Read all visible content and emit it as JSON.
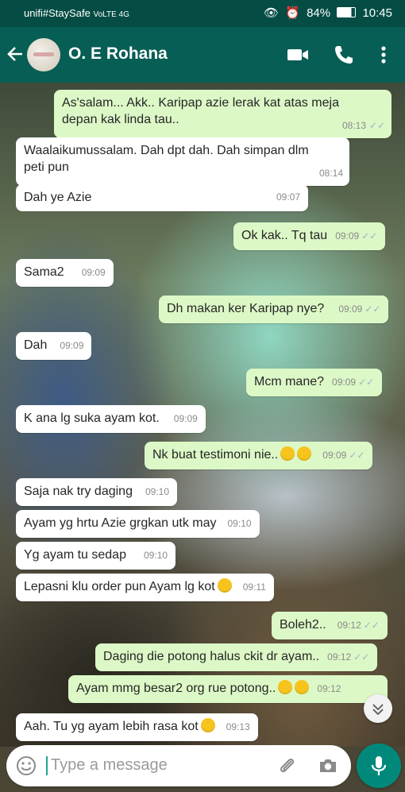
{
  "status_bar": {
    "carrier": "unifi#StaySafe",
    "network_badges": "VoLTE 4G",
    "battery": "84%",
    "time": "10:45"
  },
  "header": {
    "contact_name": "O. E Rohana"
  },
  "messages": [
    {
      "dir": "out",
      "lines": [
        "As'salam... Akk.. Karipap azie lerak kat atas meja",
        "depan kak linda tau.."
      ],
      "time": "08:13"
    },
    {
      "dir": "in",
      "lines": [
        "Waalaikumussalam. Dah dpt dah. Dah simpan dlm",
        "peti pun"
      ],
      "time": "08:14"
    },
    {
      "dir": "in",
      "text": "Dah ye Azie",
      "time": "09:07"
    },
    {
      "dir": "out",
      "text": "Ok kak.. Tq tau",
      "time": "09:09"
    },
    {
      "dir": "in",
      "text": "Sama2",
      "time": "09:09"
    },
    {
      "dir": "out",
      "text": "Dh makan ker Karipap nye?",
      "time": "09:09"
    },
    {
      "dir": "in",
      "text": "Dah",
      "time": "09:09"
    },
    {
      "dir": "out",
      "text": "Mcm mane?",
      "time": "09:09"
    },
    {
      "dir": "in",
      "text": "K ana lg suka ayam kot.",
      "time": "09:09"
    },
    {
      "dir": "out",
      "text": "Nk buat testimoni nie..",
      "emoji": "grin-sweat x2",
      "time": "09:09"
    },
    {
      "dir": "in",
      "text": "Saja nak try daging",
      "time": "09:10"
    },
    {
      "dir": "in",
      "text": "Ayam yg hrtu Azie grgkan utk may",
      "time": "09:10"
    },
    {
      "dir": "in",
      "text": "Yg ayam tu sedap",
      "time": "09:10"
    },
    {
      "dir": "in",
      "text": "Lepasni klu order pun Ayam lg kot",
      "emoji": "smile",
      "time": "09:11"
    },
    {
      "dir": "out",
      "text": "Boleh2..",
      "time": "09:12"
    },
    {
      "dir": "out",
      "text": "Daging die potong halus ckit dr ayam..",
      "time": "09:12"
    },
    {
      "dir": "out",
      "text": "Ayam mmg besar2 org rue potong..",
      "emoji": "tears-joy x2",
      "time": "09:12"
    },
    {
      "dir": "in",
      "text": "Aah. Tu yg ayam lebih rasa kot",
      "emoji": "blush",
      "time": "09:13"
    }
  ],
  "composer": {
    "placeholder": "Type a message"
  },
  "icons": [
    "back-arrow-icon",
    "video-call-icon",
    "phone-icon",
    "more-options-icon",
    "emoji-icon",
    "attach-icon",
    "camera-icon",
    "mic-icon",
    "scroll-down-icon",
    "read-ticks-icon"
  ],
  "colors": {
    "header": "#075e54",
    "status_bar": "#054d44",
    "outgoing_bubble": "#dcf8c6",
    "incoming_bubble": "#ffffff",
    "mic_button": "#00897b",
    "read_ticks": "#9db4c6"
  }
}
